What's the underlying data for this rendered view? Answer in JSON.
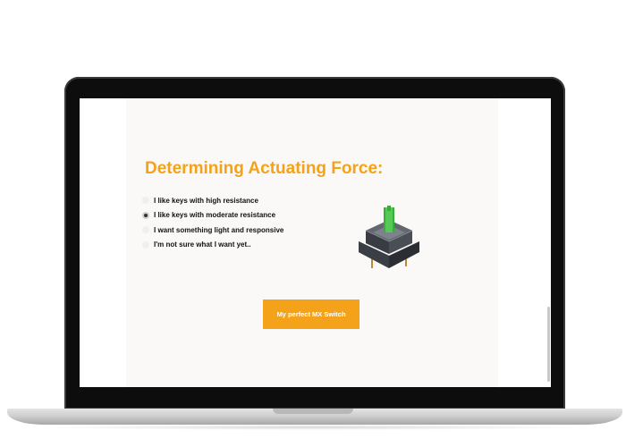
{
  "form": {
    "heading": "Determining Actuating Force:",
    "options": [
      {
        "label": "I like keys with high resistance",
        "checked": false
      },
      {
        "label": "I like keys with moderate resistance",
        "checked": true
      },
      {
        "label": "I want something light and responsive",
        "checked": false
      },
      {
        "label": "I'm not sure what I want yet..",
        "checked": false
      }
    ],
    "submit_label": "My perfect MX Switch"
  },
  "colors": {
    "accent": "#f5a21b",
    "page_background": "#faf9f7",
    "switch_stem": "#3bab3b"
  },
  "image": {
    "icon": "mx-switch-image"
  }
}
